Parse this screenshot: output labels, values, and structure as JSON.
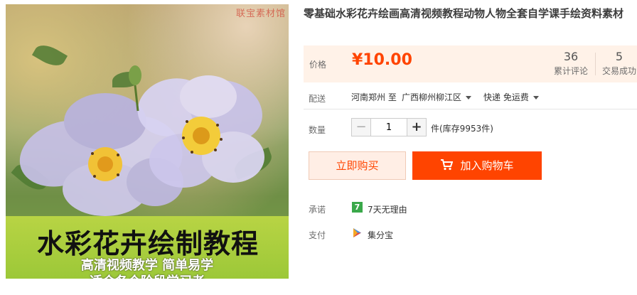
{
  "image": {
    "watermark": "联宝素材馆",
    "banner_title": "水彩花卉绘制教程",
    "banner_subtitle1": "高清视频教学 简单易学",
    "banner_subtitle2": "适合各个阶段学习者"
  },
  "product": {
    "title": "零基础水彩花卉绘画高清视频教程动物人物全套自学课手绘资料素材"
  },
  "price": {
    "label": "价格",
    "value": "¥10.00",
    "reviews_count": "36",
    "reviews_label": "累计评论",
    "sales_count": "5",
    "sales_label": "交易成功"
  },
  "shipping": {
    "label": "配送",
    "from": "河南郑州 至",
    "to": "广西柳州柳江区",
    "method": "快递 免运费"
  },
  "quantity": {
    "label": "数量",
    "value": "1",
    "unit_stock": "件(库存9953件)"
  },
  "actions": {
    "buy_now": "立即购买",
    "add_cart": "加入购物车"
  },
  "promise": {
    "label": "承诺",
    "badge": "7",
    "text": "7天无理由"
  },
  "payment": {
    "label": "支付",
    "text": "集分宝"
  },
  "colors": {
    "accent": "#ff4400",
    "price_bg": "#fff2e8",
    "badge_green": "#3aa84a"
  }
}
